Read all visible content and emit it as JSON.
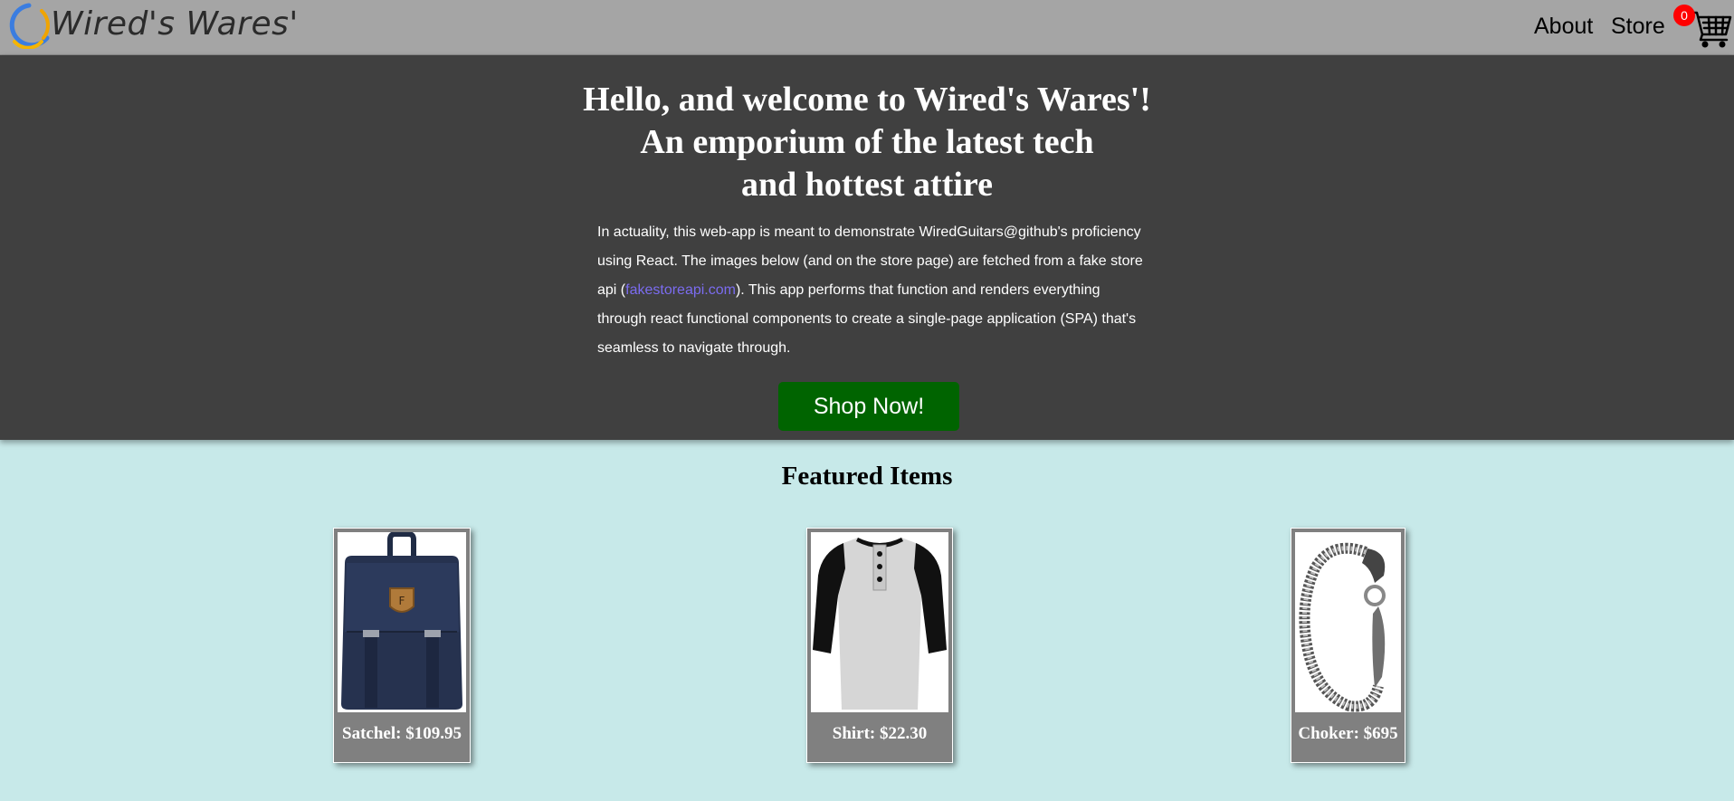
{
  "header": {
    "brand": "Wired's Wares'",
    "nav": [
      {
        "label": "About"
      },
      {
        "label": "Store"
      }
    ],
    "cart_count": "0"
  },
  "hero": {
    "title_lines": [
      "Hello, and welcome to Wired's Wares'!",
      "An emporium of the latest tech",
      "and hottest attire"
    ],
    "description_before_link": "In actuality, this web-app is meant to demonstrate WiredGuitars@github's proficiency using React. The images below (and on the store page) are fetched from a fake store api (",
    "description_link": "fakestoreapi.com",
    "description_after_link": "). This app performs that function and renders everything through react functional components to create a single-page application (SPA) that's seamless to navigate through.",
    "cta_label": "Shop Now!"
  },
  "featured": {
    "title": "Featured Items",
    "items": [
      {
        "caption": "Satchel: $109.95",
        "image": "navy-backpack"
      },
      {
        "caption": "Shirt: $22.30",
        "image": "raglan-henley-shirt"
      },
      {
        "caption": "Choker: $695",
        "image": "silver-dragon-bracelet"
      }
    ]
  },
  "colors": {
    "header_bg": "#a5a5a5",
    "hero_bg": "#404040",
    "page_bg": "#c7e9e9",
    "cta_bg": "#006400",
    "link": "#7b6cf0",
    "badge": "#ff0000",
    "card_bg": "#808080"
  }
}
